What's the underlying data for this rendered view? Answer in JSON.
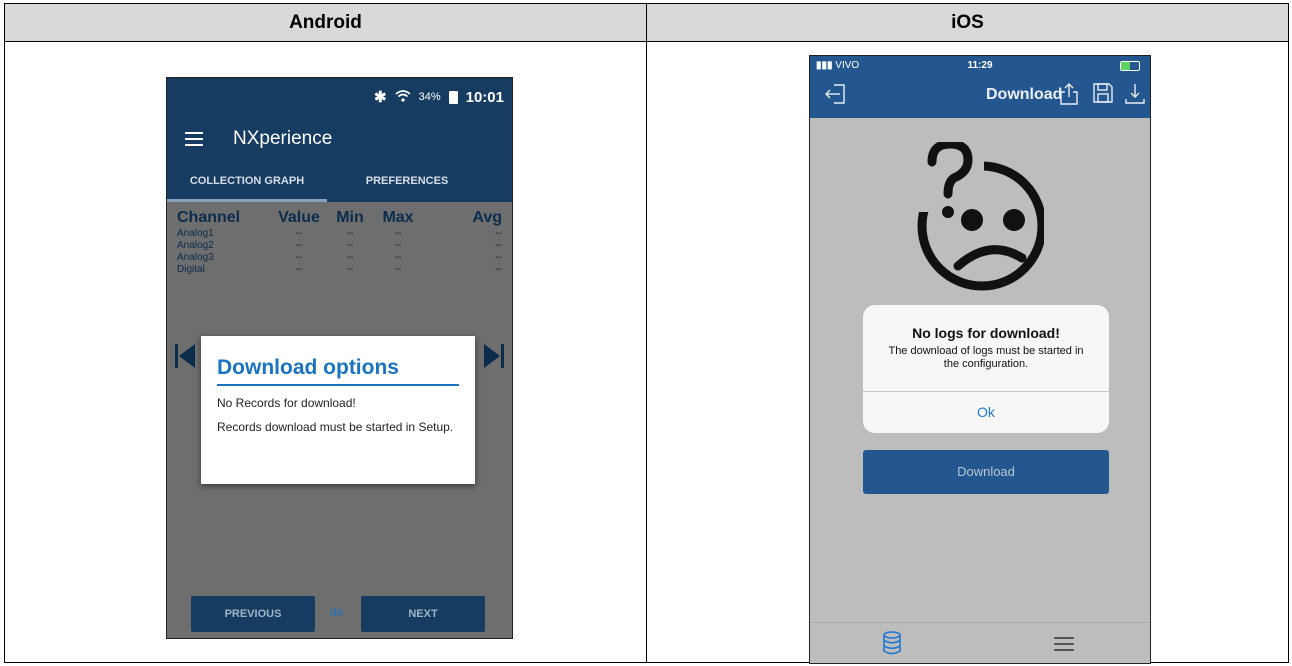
{
  "table": {
    "headers": [
      "Android",
      "iOS"
    ]
  },
  "android": {
    "status_bar": {
      "bluetooth_icon": "bluetooth-icon",
      "wifi_icon": "wifi-icon",
      "battery": "34%",
      "time": "10:01"
    },
    "app_bar": {
      "title": "NXperience",
      "menu_icon": "hamburger-menu-icon"
    },
    "tabs": [
      {
        "label": "COLLECTION GRAPH",
        "active": true
      },
      {
        "label": "PREFERENCES",
        "active": false
      }
    ],
    "table": {
      "columns": [
        "Channel",
        "Value",
        "Min",
        "Max",
        "Avg"
      ],
      "rows": [
        {
          "channel": "Analog1",
          "value": "--",
          "min": "--",
          "max": "--",
          "avg": "--"
        },
        {
          "channel": "Analog2",
          "value": "--",
          "min": "--",
          "max": "--",
          "avg": "--"
        },
        {
          "channel": "Analog3",
          "value": "--",
          "min": "--",
          "max": "--",
          "avg": "--"
        },
        {
          "channel": "Digital",
          "value": "--",
          "min": "--",
          "max": "--",
          "avg": "--"
        }
      ]
    },
    "dialog": {
      "title": "Download options",
      "message1": "No Records for download!",
      "message2": "Records download must be started in Setup."
    },
    "footer": {
      "previous_label": "PREVIOUS",
      "separator": "de",
      "next_label": "NEXT"
    },
    "colors": {
      "primary": "#173c62",
      "accent": "#1a74c0"
    }
  },
  "ios": {
    "status_bar": {
      "carrier": "VIVO",
      "time": "11:29"
    },
    "nav_bar": {
      "title": "Download",
      "icons": [
        "exit-icon",
        "share-icon",
        "save-icon",
        "download-icon"
      ]
    },
    "alert": {
      "title": "No logs for download!",
      "message": "The download of logs must be started in the configuration.",
      "ok_label": "Ok"
    },
    "download_button": "Download",
    "tab_bar": {
      "icons": [
        "database-icon",
        "menu-icon"
      ]
    },
    "colors": {
      "primary": "#24578f",
      "link": "#1e78d2"
    }
  }
}
